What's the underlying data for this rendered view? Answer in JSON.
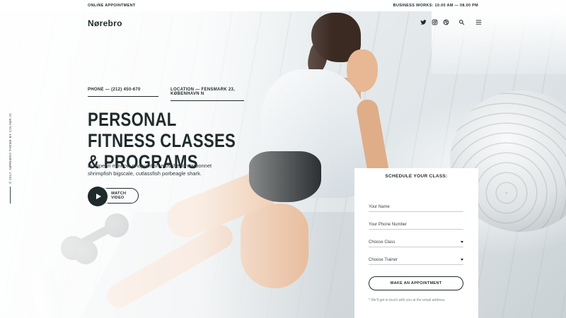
{
  "topbar": {
    "left_text": "ONLINE APPOINTMENT",
    "right_text": "BUSINESS WORKS: 10.00 AM — 08.00 PM"
  },
  "header": {
    "logo": "Nørebro",
    "icons": [
      "twitter-icon",
      "instagram-icon",
      "dribbble-icon",
      "search-icon",
      "menu-icon"
    ]
  },
  "side": {
    "copyright": "© 2017, NØREBRO THEME BY COLABR.IO"
  },
  "contact": {
    "phone": "PHONE — (212) 450-670",
    "location": "LOCATION — FENSMARK 23, KØBENHAVN N"
  },
  "hero": {
    "title": "PERSONAL FITNESS CLASSES & PROGRAMS",
    "subtitle": "European minnow priapumfish mosshead warbonnet shrimpfish bigscale, cutlassfish porbeagle shark.",
    "watch_label": "WATCH VIDEO"
  },
  "form": {
    "title": "SCHEDULE YOUR CLASS:",
    "name_placeholder": "Your Name",
    "phone_placeholder": "Your Phone Number",
    "class_select": "Choose Class",
    "trainer_select": "Choose Trainer",
    "button": "MAKE AN APPOINTMENT",
    "note": "* We'll get in touch with you at the email address."
  },
  "colors": {
    "text_dark": "#1f2a2c",
    "form_bg": "#ffffff",
    "accent": "#1f2a2c"
  }
}
